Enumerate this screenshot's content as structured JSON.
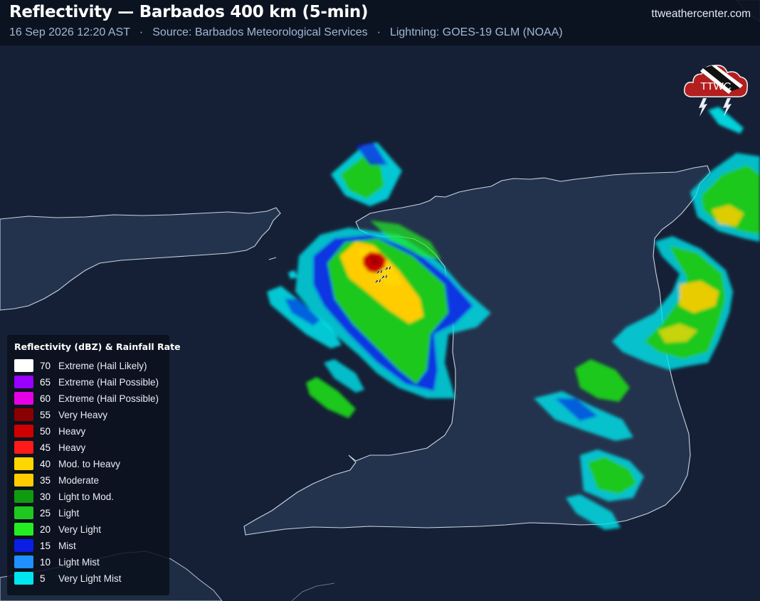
{
  "header": {
    "title": "Reflectivity — Barbados 400 km (5-min)",
    "timestamp": "16 Sep 2026 12:20 AST",
    "separator": "·",
    "source": "Source: Barbados Meteorological Services",
    "lightning": "Lightning: GOES-19 GLM (NOAA)",
    "site": "ttweathercenter.com"
  },
  "logo": {
    "text": "TTWC",
    "icon": "storm-cloud-lightning-flag-icon"
  },
  "legend": {
    "title": "Reflectivity (dBZ) & Rainfall Rate",
    "items": [
      {
        "dbz": "70",
        "label": "Extreme (Hail Likely)",
        "color": "#ffffff"
      },
      {
        "dbz": "65",
        "label": "Extreme (Hail Possible)",
        "color": "#9900ff"
      },
      {
        "dbz": "60",
        "label": "Extreme (Hail Possible)",
        "color": "#e600e6"
      },
      {
        "dbz": "55",
        "label": "Very Heavy",
        "color": "#8b0000"
      },
      {
        "dbz": "50",
        "label": "Heavy",
        "color": "#cc0000"
      },
      {
        "dbz": "45",
        "label": "Heavy",
        "color": "#ff1a1a"
      },
      {
        "dbz": "40",
        "label": "Mod. to Heavy",
        "color": "#ffd700"
      },
      {
        "dbz": "35",
        "label": "Moderate",
        "color": "#ffcc00"
      },
      {
        "dbz": "30",
        "label": "Light to Mod.",
        "color": "#109a10"
      },
      {
        "dbz": "25",
        "label": "Light",
        "color": "#1ec81e"
      },
      {
        "dbz": "20",
        "label": "Very Light",
        "color": "#22ee22"
      },
      {
        "dbz": "15",
        "label": "Mist",
        "color": "#0a1ee6"
      },
      {
        "dbz": "10",
        "label": "Light Mist",
        "color": "#1e90ff"
      },
      {
        "dbz": "5",
        "label": "Very Light Mist",
        "color": "#00e5ee"
      }
    ]
  }
}
